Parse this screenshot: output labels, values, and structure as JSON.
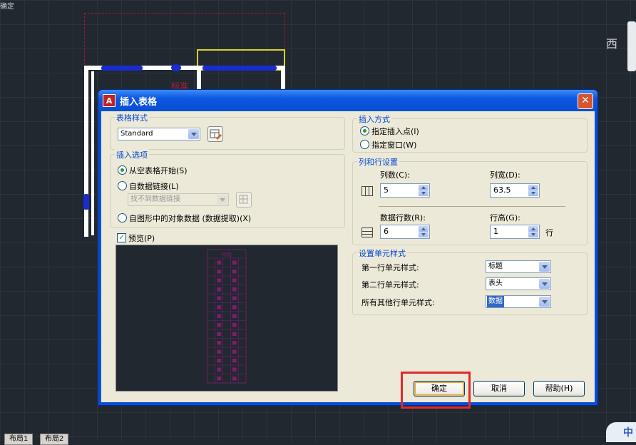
{
  "cad": {
    "top_text": "确定",
    "cad_label": "标准",
    "compass_letter": "西",
    "layout_tabs": [
      "布局1",
      "布局2"
    ],
    "ime_label": "中"
  },
  "dialog": {
    "title": "插入表格",
    "table_style": {
      "group_label": "表格样式",
      "value": "Standard"
    },
    "insert_options": {
      "group_label": "插入选项",
      "options": [
        "从空表格开始(S)",
        "自数据链接(L)",
        "自图形中的对象数据 (数据提取)(X)"
      ],
      "selected": 0,
      "data_link_value": "找不到数据链接"
    },
    "preview": {
      "label": "预览(P)",
      "checked": true,
      "header_text": "标题",
      "columns": 5,
      "rows": 14
    },
    "insert_method": {
      "group_label": "插入方式",
      "options": [
        "指定插入点(I)",
        "指定窗口(W)"
      ],
      "selected": 0
    },
    "col_row": {
      "group_label": "列和行设置",
      "columns_label": "列数(C):",
      "columns_value": "5",
      "col_width_label": "列宽(D):",
      "col_width_value": "63.5",
      "data_rows_label": "数据行数(R):",
      "data_rows_value": "6",
      "row_height_label": "行高(G):",
      "row_height_value": "1",
      "row_unit": "行"
    },
    "cell_styles": {
      "group_label": "设置单元样式",
      "first_row_label": "第一行单元样式:",
      "first_row_value": "标题",
      "second_row_label": "第二行单元样式:",
      "second_row_value": "表头",
      "other_rows_label": "所有其他行单元样式:",
      "other_rows_value": "数据"
    },
    "buttons": {
      "ok": "确定",
      "cancel": "取消",
      "help": "帮助(H)"
    }
  },
  "colors": {
    "accent": "#0a4ed8",
    "highlight": "#e12a2a",
    "cad_background": "#212830",
    "preview_lines": "#7a1f6a"
  }
}
